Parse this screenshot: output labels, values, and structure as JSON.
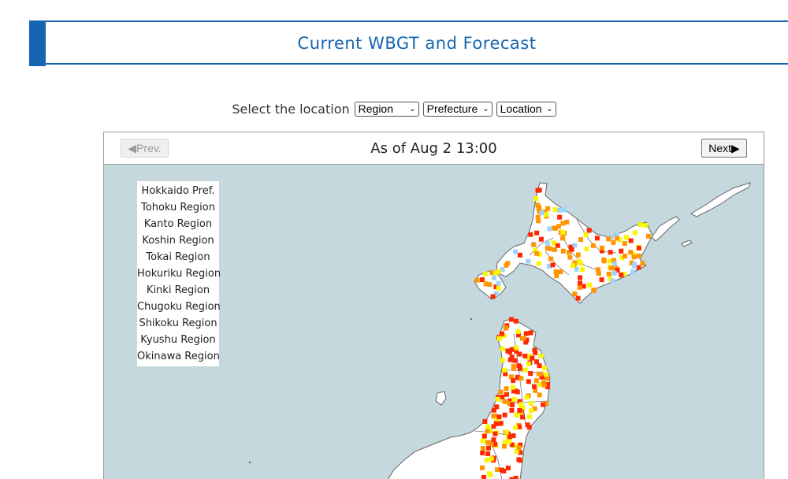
{
  "header": {
    "title": "Current WBGT and Forecast"
  },
  "location_selector": {
    "label": "Select the location",
    "region": "Region",
    "prefecture": "Prefecture",
    "location": "Location"
  },
  "map": {
    "timestamp": "As of Aug 2 13:00",
    "prev_label": "◀Prev.",
    "next_label": "Next▶",
    "regions": [
      "Hokkaido Pref.",
      "Tohoku Region",
      "Kanto Region",
      "Koshin Region",
      "Tokai Region",
      "Hokuriku Region",
      "Kinki Region",
      "Chugoku Region",
      "Shikoku Region",
      "Kyushu Region",
      "Okinawa Region"
    ],
    "colors": {
      "sea": "#c5d8dd",
      "land": "#ffffff",
      "border": "#666666",
      "danger": "#ff2800",
      "severe_warning": "#ff9600",
      "warning": "#faf500",
      "caution": "#a0d2ff"
    }
  }
}
